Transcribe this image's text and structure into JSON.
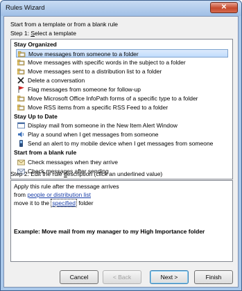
{
  "window": {
    "title": "Rules Wizard",
    "close_label": "✕"
  },
  "intro": "Start from a template or from a blank rule",
  "step1": {
    "prefix": "Step 1: ",
    "u": "S",
    "rest": "elect a template"
  },
  "groups": [
    {
      "title": "Stay Organized",
      "items": [
        {
          "label": "Move messages from someone to a folder",
          "icon": "folder-move-icon",
          "selected": true
        },
        {
          "label": "Move messages with specific words in the subject to a folder",
          "icon": "folder-move-icon"
        },
        {
          "label": "Move messages sent to a distribution list to a folder",
          "icon": "folder-move-icon"
        },
        {
          "label": "Delete a conversation",
          "icon": "delete-x-icon"
        },
        {
          "label": "Flag messages from someone for follow-up",
          "icon": "red-flag-icon"
        },
        {
          "label": "Move Microsoft Office InfoPath forms of a specific type to a folder",
          "icon": "folder-move-icon"
        },
        {
          "label": "Move RSS items from a specific RSS Feed to a folder",
          "icon": "folder-move-icon"
        }
      ]
    },
    {
      "title": "Stay Up to Date",
      "items": [
        {
          "label": "Display mail from someone in the New Item Alert Window",
          "icon": "alert-window-icon"
        },
        {
          "label": "Play a sound when I get messages from someone",
          "icon": "speaker-icon"
        },
        {
          "label": "Send an alert to my mobile device when I get messages from someone",
          "icon": "mobile-device-icon"
        }
      ]
    },
    {
      "title": "Start from a blank rule",
      "items": [
        {
          "label": "Check messages when they arrive",
          "icon": "envelope-icon"
        },
        {
          "label": "Check messages after sending",
          "icon": "envelope-send-icon"
        }
      ]
    }
  ],
  "step2": {
    "prefix": "Step 2: Edit the rule ",
    "u": "d",
    "rest": "escription (click an underlined value)"
  },
  "description": {
    "line1": "Apply this rule after the message arrives",
    "line2_prefix": "from ",
    "line2_link": "people or distribution list",
    "line3_prefix": "move it to the ",
    "line3_link": "specified",
    "line3_suffix": " folder",
    "example": "Example: Move mail from my manager to my High Importance folder"
  },
  "buttons": {
    "cancel": "Cancel",
    "back": "< Back",
    "next": "Next >",
    "finish": "Finish"
  }
}
